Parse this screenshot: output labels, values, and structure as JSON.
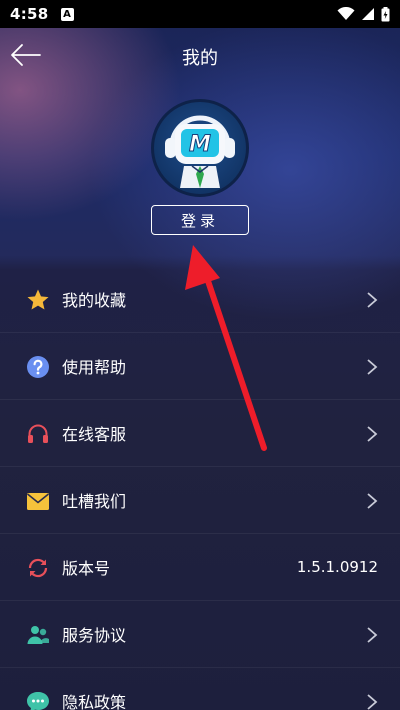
{
  "status_bar": {
    "time": "4:58",
    "notification_glyph": "A",
    "icons": [
      "wifi-icon",
      "signal-icon",
      "battery-icon"
    ]
  },
  "header": {
    "title": "我的",
    "back_icon": "arrow-left-icon"
  },
  "profile": {
    "avatar_icon": "robot-mascot-avatar",
    "avatar_letter": "M",
    "login_label": "登录"
  },
  "menu": {
    "items": [
      {
        "label": "我的收藏",
        "icon": "star-icon",
        "icon_color": "#f5b83a"
      },
      {
        "label": "使用帮助",
        "icon": "question-circle-icon",
        "icon_color": "#6a8ff0"
      },
      {
        "label": "在线客服",
        "icon": "headphones-icon",
        "icon_color": "#e8505a"
      },
      {
        "label": "吐槽我们",
        "icon": "envelope-icon",
        "icon_color": "#f6c23b"
      },
      {
        "label": "版本号",
        "icon": "refresh-icon",
        "icon_color": "#e8505a",
        "value": "1.5.1.0912"
      },
      {
        "label": "服务协议",
        "icon": "users-icon",
        "icon_color": "#3fc3a8"
      },
      {
        "label": "隐私政策",
        "icon": "chat-bubble-icon",
        "icon_color": "#3fc3a8"
      }
    ]
  },
  "annotation": {
    "color": "#ee1d2a",
    "icon": "red-arrow-annotation"
  }
}
